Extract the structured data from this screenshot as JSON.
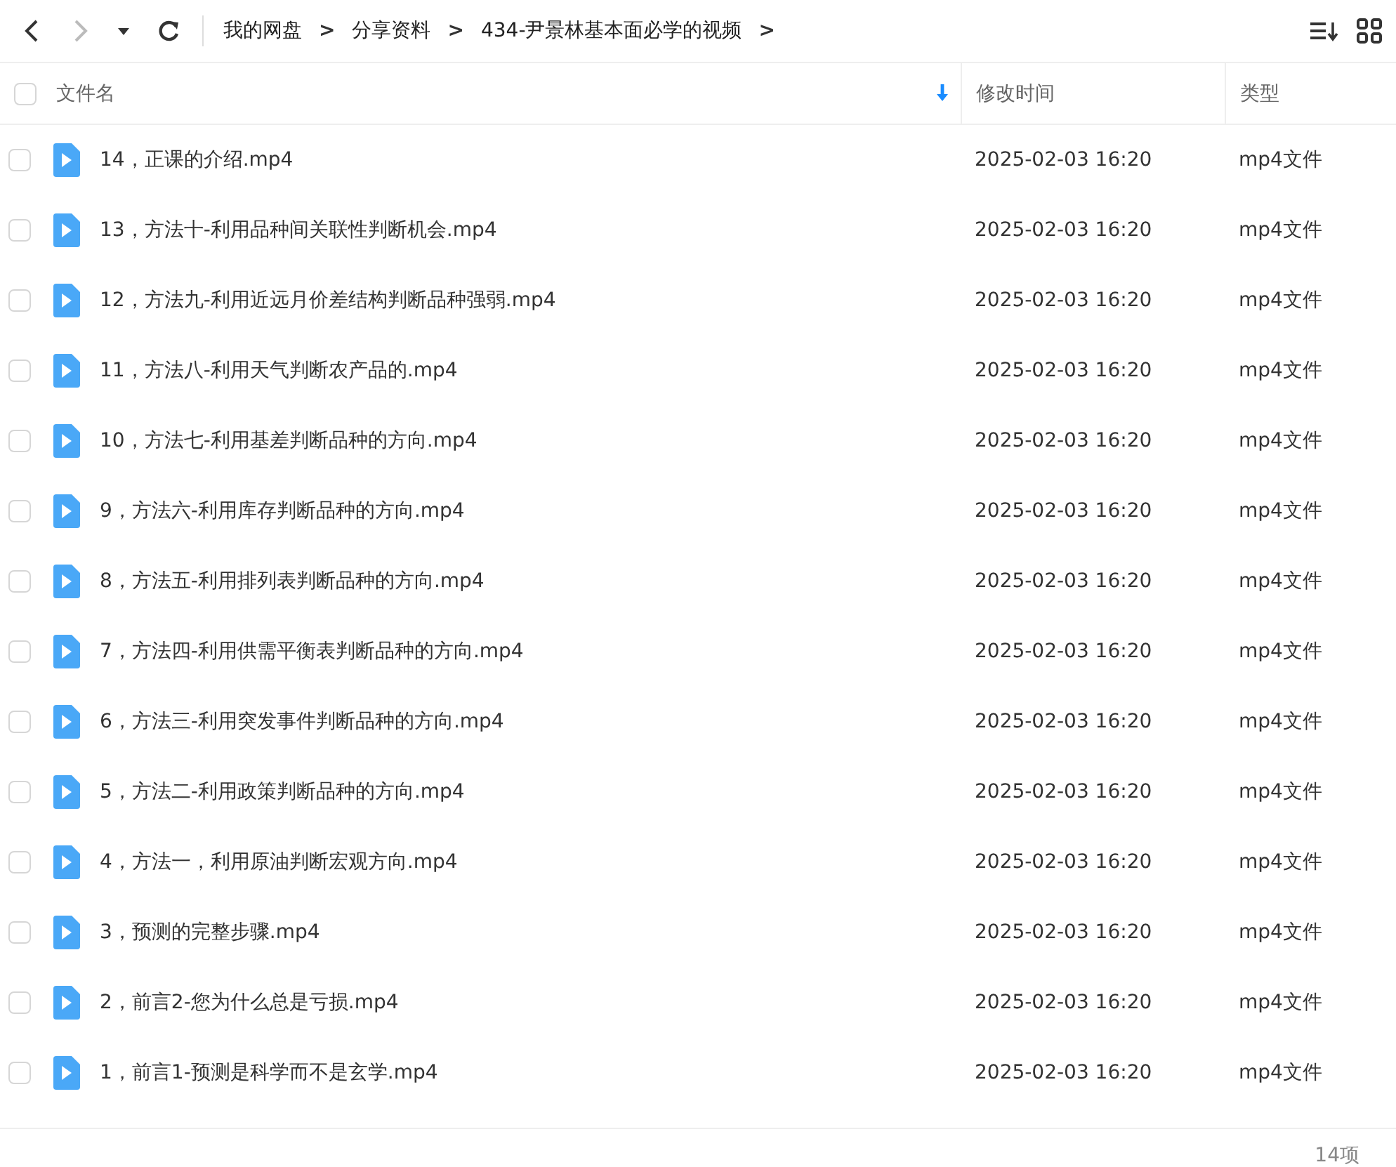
{
  "toolbar": {
    "nav": [
      {
        "kind": "back",
        "disabled": false
      },
      {
        "kind": "forward",
        "disabled": true
      },
      {
        "kind": "history",
        "disabled": false
      },
      {
        "kind": "refresh",
        "disabled": false
      }
    ],
    "breadcrumb": [
      {
        "label": "我的网盘",
        "separator": ">"
      },
      {
        "label": "分享资料",
        "separator": ">"
      },
      {
        "label": "434-尹景林基本面必学的视频",
        "separator": ">"
      }
    ],
    "tools": [
      {
        "kind": "sort"
      },
      {
        "kind": "grid"
      }
    ]
  },
  "table": {
    "select_all": {
      "checked": false
    },
    "columns": [
      {
        "label": "文件名",
        "sorted": true
      },
      {
        "label": "修改时间",
        "sorted": false
      },
      {
        "label": "类型",
        "sorted": false
      }
    ],
    "rows": [
      {
        "name": "14，正课的介绍.mp4",
        "modified": "2025-02-03 16:20",
        "type": "mp4文件",
        "checked": false
      },
      {
        "name": "13，方法十-利用品种间关联性判断机会.mp4",
        "modified": "2025-02-03 16:20",
        "type": "mp4文件",
        "checked": false
      },
      {
        "name": "12，方法九-利用近远月价差结构判断品种强弱.mp4",
        "modified": "2025-02-03 16:20",
        "type": "mp4文件",
        "checked": false
      },
      {
        "name": "11，方法八-利用天气判断农产品的.mp4",
        "modified": "2025-02-03 16:20",
        "type": "mp4文件",
        "checked": false
      },
      {
        "name": "10，方法七-利用基差判断品种的方向.mp4",
        "modified": "2025-02-03 16:20",
        "type": "mp4文件",
        "checked": false
      },
      {
        "name": "9，方法六-利用库存判断品种的方向.mp4",
        "modified": "2025-02-03 16:20",
        "type": "mp4文件",
        "checked": false
      },
      {
        "name": "8，方法五-利用排列表判断品种的方向.mp4",
        "modified": "2025-02-03 16:20",
        "type": "mp4文件",
        "checked": false
      },
      {
        "name": "7，方法四-利用供需平衡表判断品种的方向.mp4",
        "modified": "2025-02-03 16:20",
        "type": "mp4文件",
        "checked": false
      },
      {
        "name": "6，方法三-利用突发事件判断品种的方向.mp4",
        "modified": "2025-02-03 16:20",
        "type": "mp4文件",
        "checked": false
      },
      {
        "name": "5，方法二-利用政策判断品种的方向.mp4",
        "modified": "2025-02-03 16:20",
        "type": "mp4文件",
        "checked": false
      },
      {
        "name": "4，方法一，利用原油判断宏观方向.mp4",
        "modified": "2025-02-03 16:20",
        "type": "mp4文件",
        "checked": false
      },
      {
        "name": "3，预测的完整步骤.mp4",
        "modified": "2025-02-03 16:20",
        "type": "mp4文件",
        "checked": false
      },
      {
        "name": "2，前言2-您为什么总是亏损.mp4",
        "modified": "2025-02-03 16:20",
        "type": "mp4文件",
        "checked": false
      },
      {
        "name": "1，前言1-预测是科学而不是玄学.mp4",
        "modified": "2025-02-03 16:20",
        "type": "mp4文件",
        "checked": false
      }
    ]
  },
  "status_bar": {
    "count": "14项"
  }
}
